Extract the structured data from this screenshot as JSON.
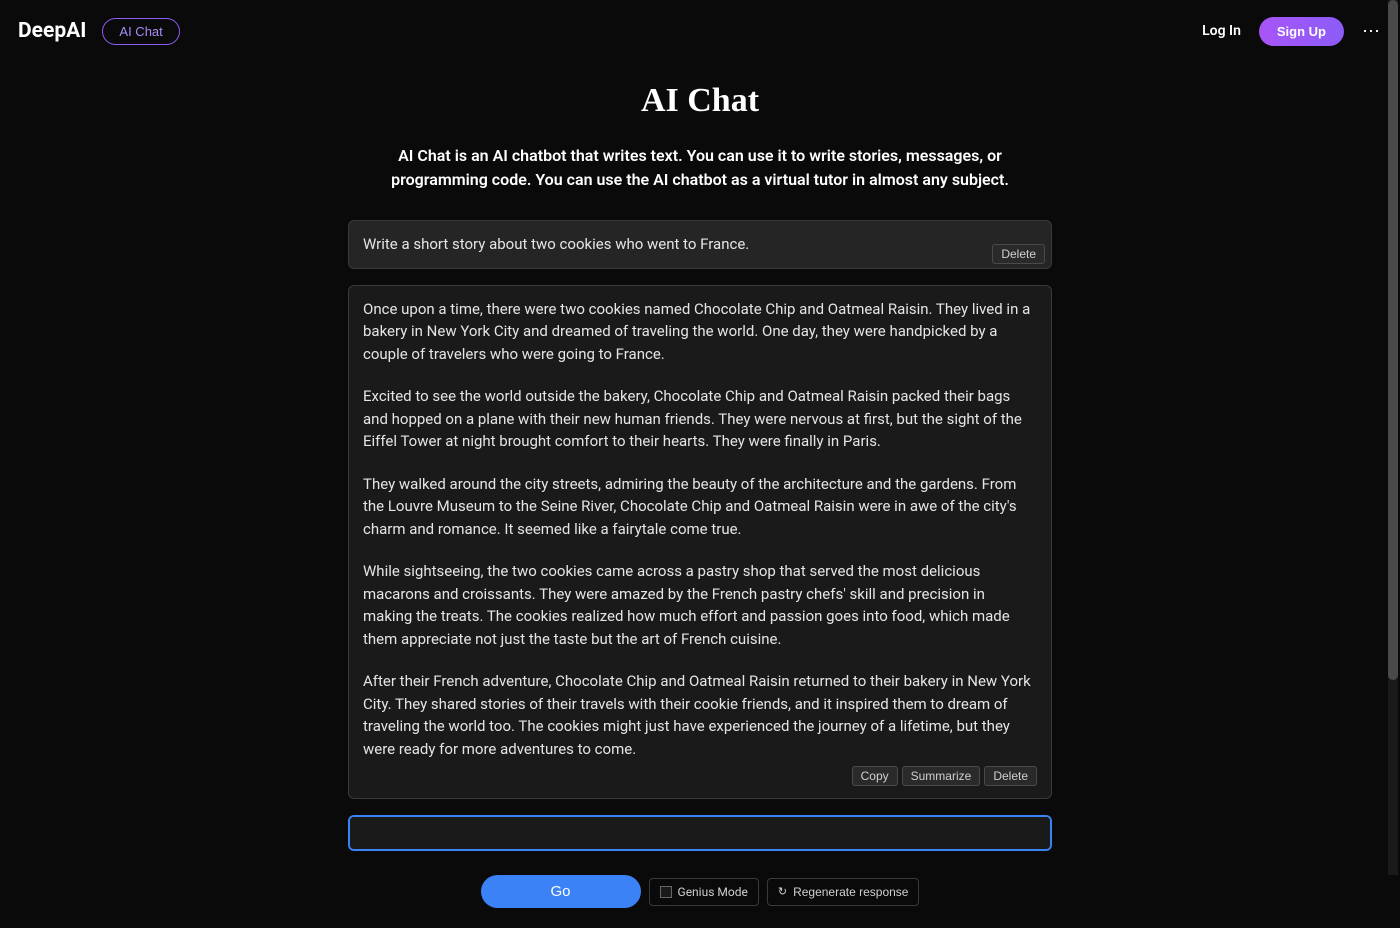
{
  "header": {
    "logo": "DeepAI",
    "ai_chat_label": "AI Chat",
    "login_label": "Log In",
    "signup_label": "Sign Up"
  },
  "page": {
    "title": "AI Chat",
    "description": "AI Chat is an AI chatbot that writes text. You can use it to write stories, messages, or programming code. You can use the AI chatbot as a virtual tutor in almost any subject."
  },
  "conversation": {
    "user_message": "Write a short story about two cookies who went to France.",
    "user_actions": {
      "delete": "Delete"
    },
    "ai_response": {
      "paragraphs": [
        "Once upon a time, there were two cookies named Chocolate Chip and Oatmeal Raisin. They lived in a bakery in New York City and dreamed of traveling the world. One day, they were handpicked by a couple of travelers who were going to France.",
        "Excited to see the world outside the bakery, Chocolate Chip and Oatmeal Raisin packed their bags and hopped on a plane with their new human friends. They were nervous at first, but the sight of the Eiffel Tower at night brought comfort to their hearts. They were finally in Paris.",
        "They walked around the city streets, admiring the beauty of the architecture and the gardens. From the Louvre Museum to the Seine River, Chocolate Chip and Oatmeal Raisin were in awe of the city's charm and romance. It seemed like a fairytale come true.",
        "While sightseeing, the two cookies came across a pastry shop that served the most delicious macarons and croissants. They were amazed by the French pastry chefs' skill and precision in making the treats. The cookies realized how much effort and passion goes into food, which made them appreciate not just the taste but the art of French cuisine.",
        "After their French adventure, Chocolate Chip and Oatmeal Raisin returned to their bakery in New York City. They shared stories of their travels with their cookie friends, and it inspired them to dream of traveling the world too. The cookies might just have experienced the journey of a lifetime, but they were ready for more adventures to come."
      ]
    },
    "ai_actions": {
      "copy": "Copy",
      "summarize": "Summarize",
      "delete": "Delete"
    }
  },
  "controls": {
    "go_label": "Go",
    "genius_mode_label": "Genius Mode",
    "regenerate_label": "Regenerate response"
  }
}
